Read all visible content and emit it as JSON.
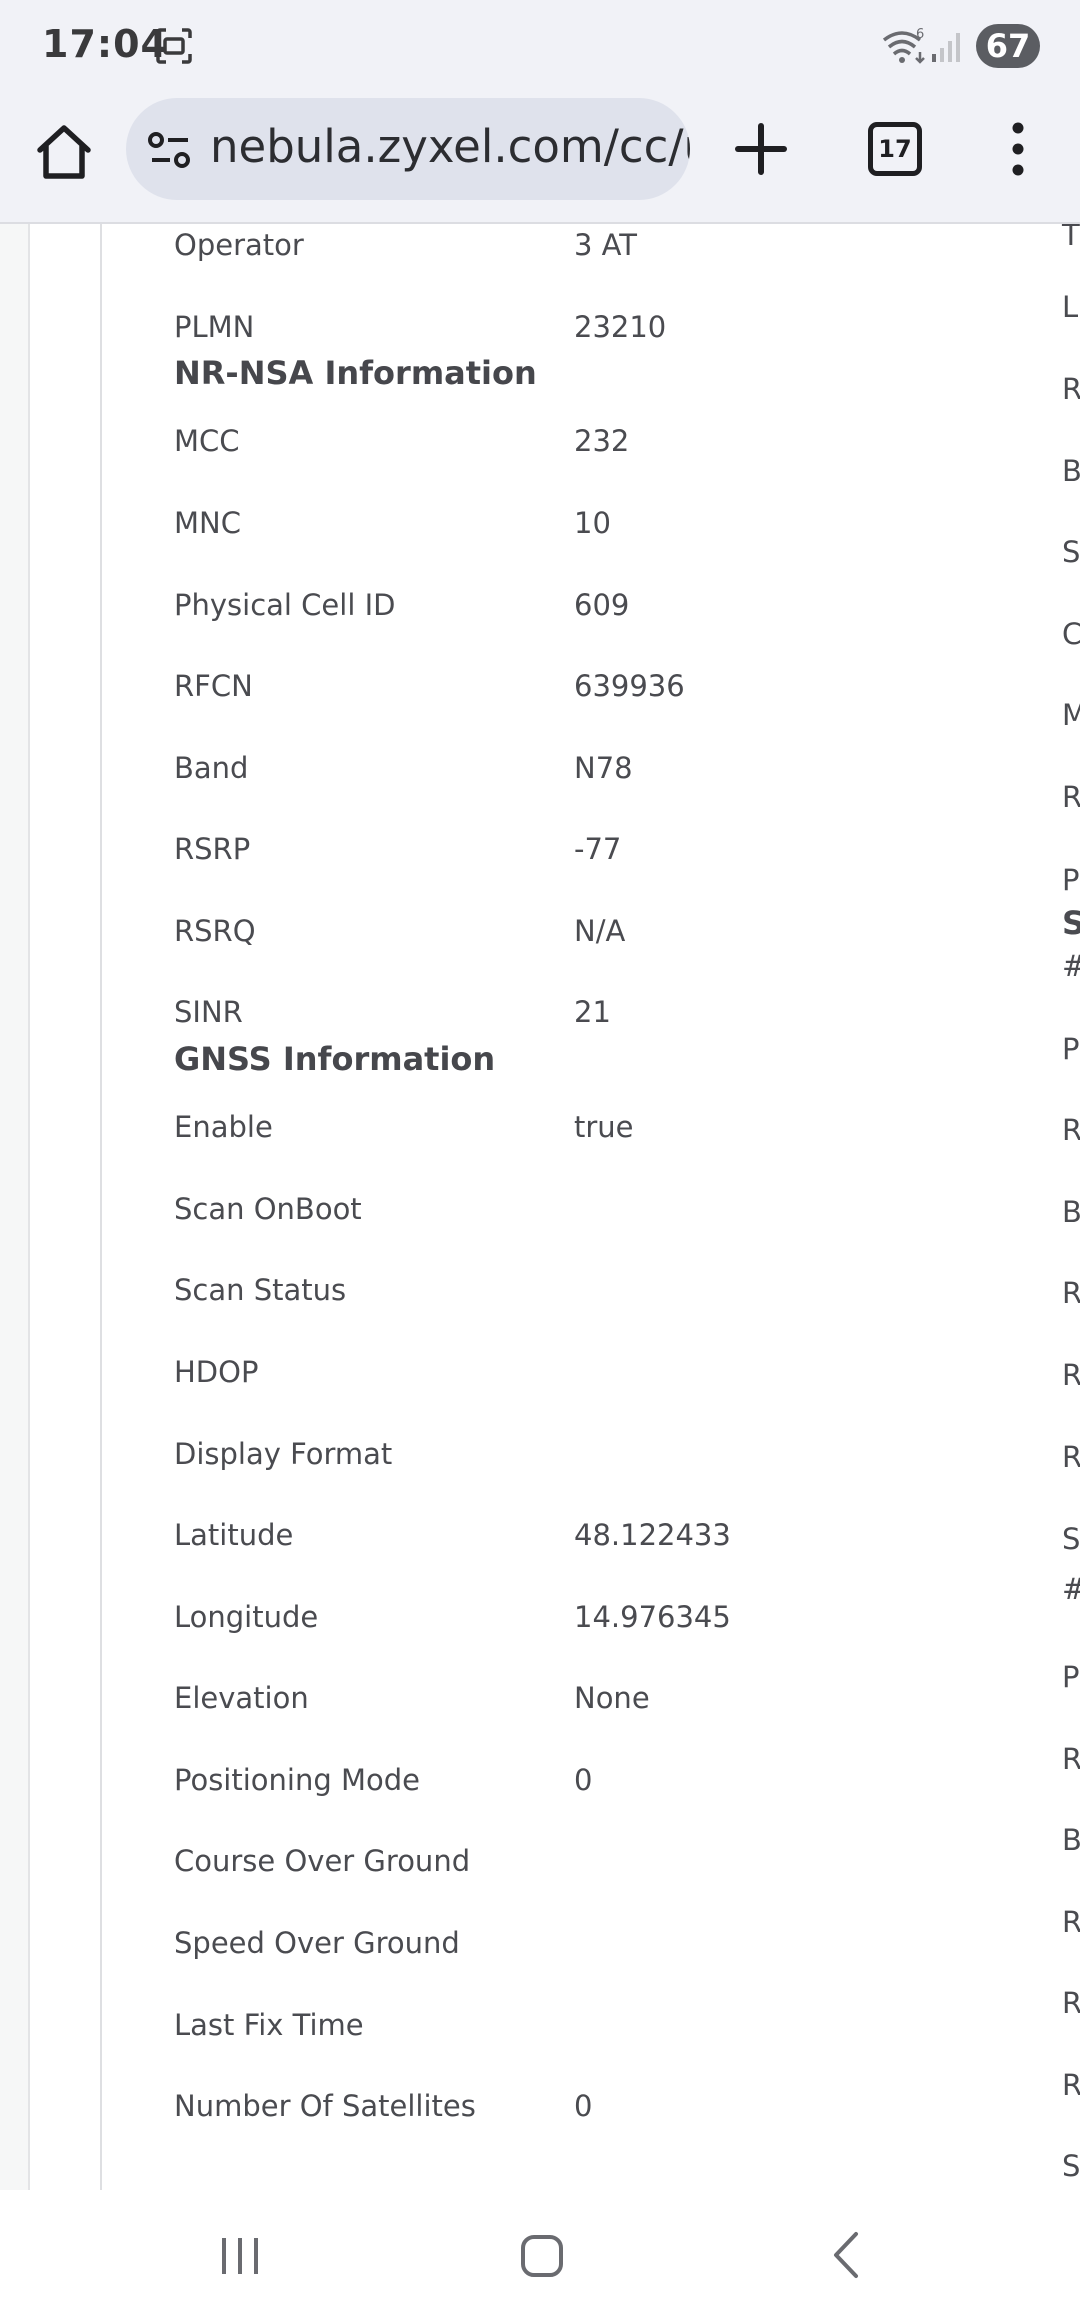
{
  "status_bar": {
    "time": "17:04",
    "battery": "67",
    "icons": [
      "screenshot-icon",
      "wifi-6-icon",
      "signal-strength-icon"
    ]
  },
  "browser": {
    "url": "nebula.zyxel.com/cc/u",
    "tab_count": "17",
    "icons": [
      "home-icon",
      "site-settings-icon",
      "new-tab-icon",
      "tab-switcher-icon",
      "more-options-icon"
    ]
  },
  "lte_tail": [
    {
      "label": "Operator",
      "value": "3 AT"
    },
    {
      "label": "PLMN",
      "value": "23210"
    }
  ],
  "nr_nsa": {
    "heading": "NR-NSA Information",
    "rows": [
      {
        "label": "MCC",
        "value": "232"
      },
      {
        "label": "MNC",
        "value": "10"
      },
      {
        "label": "Physical Cell ID",
        "value": "609"
      },
      {
        "label": "RFCN",
        "value": "639936"
      },
      {
        "label": "Band",
        "value": "N78"
      },
      {
        "label": "RSRP",
        "value": "-77"
      },
      {
        "label": "RSRQ",
        "value": "N/A"
      },
      {
        "label": "SINR",
        "value": "21"
      }
    ]
  },
  "gnss": {
    "heading": "GNSS Information",
    "rows": [
      {
        "label": "Enable",
        "value": "true"
      },
      {
        "label": "Scan OnBoot",
        "value": ""
      },
      {
        "label": "Scan Status",
        "value": ""
      },
      {
        "label": "HDOP",
        "value": ""
      },
      {
        "label": "Display Format",
        "value": ""
      },
      {
        "label": "Latitude",
        "value": "48.122433"
      },
      {
        "label": "Longitude",
        "value": "14.976345"
      },
      {
        "label": "Elevation",
        "value": "None"
      },
      {
        "label": "Positioning Mode",
        "value": "0"
      },
      {
        "label": "Course Over Ground",
        "value": ""
      },
      {
        "label": "Speed Over Ground",
        "value": ""
      },
      {
        "label": "Last Fix Time",
        "value": ""
      },
      {
        "label": "Number Of Satellites",
        "value": "0"
      }
    ]
  },
  "right_column": [
    "T",
    "L",
    "R",
    "B",
    "S",
    "C",
    "M",
    "R",
    "P",
    "S",
    "#",
    "P",
    "R",
    "B",
    "R",
    "R",
    "R",
    "S",
    "#",
    "P",
    "R",
    "B",
    "R",
    "R",
    "R",
    "S"
  ],
  "nav_bar": {
    "icons": [
      "recent-apps-icon",
      "home-nav-icon",
      "back-nav-icon"
    ]
  }
}
